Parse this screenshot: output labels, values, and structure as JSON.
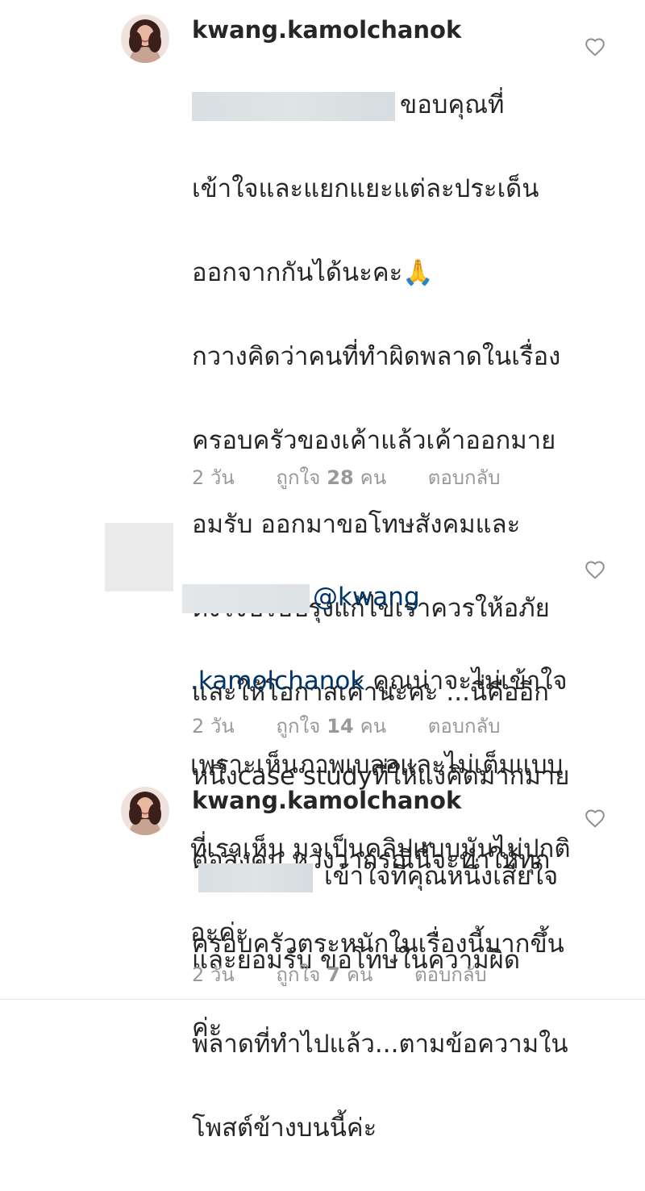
{
  "comments": [
    {
      "username": "kwang.kamolchanok",
      "lines": [
        "ขอบคุณที่",
        "เข้าใจและแยกแยะแต่ละประเด็น",
        "ออกจากกันได้นะคะ🙏",
        "กวางคิดว่าคนที่ทำผิดพลาดในเรื่อง",
        "ครอบครัวของเค้าแล้วเค้าออกมาย",
        "อมรับ ออกมาขอโทษสังคมและ",
        "ตั้งใจปรับปรุงแก้ไขเราควรให้อภัย",
        "และให้โอกาสเค้านะคะ ...นี่คืออีก",
        "หนึ่งcase studyที่ให้แง่คิดมากมาย",
        "ต่อสังคม หวังว่ากรณีนี้จะทำให้ทุก",
        "ครอบครัวตระหนักในเรื่องนี้มากขึ้น",
        "ค่ะ"
      ],
      "time": "2 วัน",
      "likes_prefix": "ถูกใจ",
      "likes_count": "28",
      "likes_suffix": "คน",
      "reply": "ตอบกลับ"
    },
    {
      "username": "",
      "mention": "@kwang",
      "mention_cont": ".kamolchanok",
      "lines": [
        "คุณน่าจะไม่เข้าใจ",
        "เพราะเห็นภาพเบลอและไม่เต็มแบบ",
        "ที่เราเห็น มาเป็นคลิปแบบมันไม่ปกติ",
        "อะค่ะ"
      ],
      "time": "2 วัน",
      "likes_prefix": "ถูกใจ",
      "likes_count": "14",
      "likes_suffix": "คน",
      "reply": "ตอบกลับ"
    },
    {
      "username": "kwang.kamolchanok",
      "lines": [
        "เข้าใจที่คุณหนึ่งเสียใจ",
        "และยอมรับ ขอโทษในความผิด",
        "พลาดที่ทำไปแล้ว...ตามข้อความใน",
        "โพสต์ข้างบนนี้ค่ะ"
      ],
      "time": "2 วัน",
      "likes_prefix": "ถูกใจ",
      "likes_count": "7",
      "likes_suffix": "คน",
      "reply": "ตอบกลับ"
    }
  ],
  "icons": {
    "heart": "heart-outline-icon",
    "avatar": "profile-avatar"
  },
  "colors": {
    "text": "#262626",
    "meta": "#999999",
    "mention": "#003569",
    "icon": "#8e8e8e"
  }
}
